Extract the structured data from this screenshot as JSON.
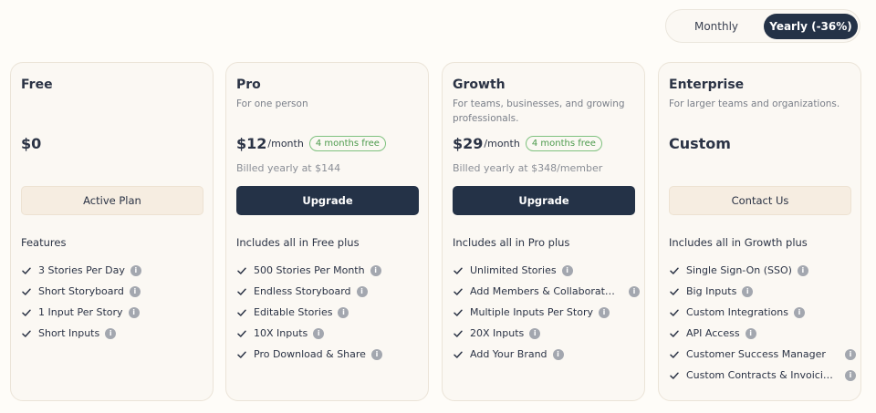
{
  "billing_toggle": {
    "monthly_label": "Monthly",
    "yearly_label": "Yearly (-36%)",
    "selected": "Yearly (-36%)"
  },
  "plans": [
    {
      "name": "Free",
      "description": "",
      "price": "$0",
      "per": "",
      "badge": "",
      "billed": "",
      "button_label": "Active Plan",
      "features_heading": "Features",
      "features": [
        "3 Stories Per Day",
        "Short Storyboard",
        "1 Input Per Story",
        "Short Inputs"
      ]
    },
    {
      "name": "Pro",
      "description": "For one person",
      "price": "$12",
      "per": "/month",
      "badge": "4 months free",
      "billed": "Billed yearly at $144",
      "button_label": "Upgrade",
      "features_heading": "Includes all in Free plus",
      "features": [
        "500 Stories Per Month",
        "Endless Storyboard",
        "Editable Stories",
        "10X Inputs",
        "Pro Download & Share"
      ]
    },
    {
      "name": "Growth",
      "description": "For teams, businesses, and growing professionals.",
      "price": "$29",
      "per": "/month",
      "badge": "4 months free",
      "billed": "Billed yearly at $348/member",
      "button_label": "Upgrade",
      "features_heading": "Includes all in Pro plus",
      "features": [
        "Unlimited Stories",
        "Add Members & Collaborators",
        "Multiple Inputs Per Story",
        "20X Inputs",
        "Add Your Brand"
      ]
    },
    {
      "name": "Enterprise",
      "description": "For larger teams and organizations.",
      "price": "Custom",
      "per": "",
      "badge": "",
      "billed": "",
      "button_label": "Contact Us",
      "features_heading": "Includes all in Growth plus",
      "features": [
        "Single Sign-On (SSO)",
        "Big Inputs",
        "Custom Integrations",
        "API Access",
        "Customer Success Manager",
        "Custom Contracts & Invoicing"
      ]
    }
  ],
  "icons": {
    "check": "check-icon",
    "info": "info-icon"
  },
  "info_glyph": "i",
  "colors": {
    "dark_button": "#243247",
    "light_button": "#f6ede1",
    "badge_green": "#4c9a4c",
    "background": "#fefcf8"
  }
}
